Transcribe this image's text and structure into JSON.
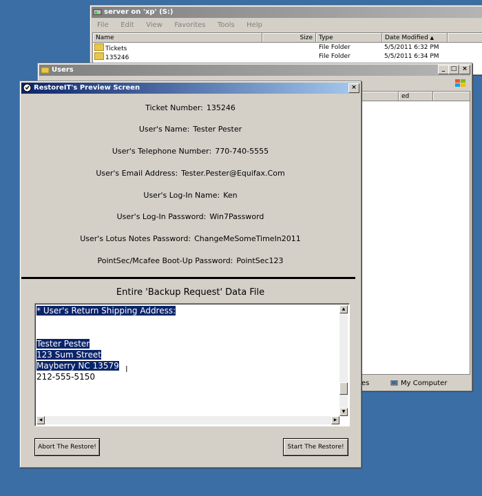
{
  "server_window": {
    "title": "server on 'xp' (S:)",
    "menu": [
      "File",
      "Edit",
      "View",
      "Favorites",
      "Tools",
      "Help"
    ],
    "columns": [
      "Name",
      "Size",
      "Type",
      "Date Modified"
    ],
    "rows": [
      {
        "name": "Tickets",
        "type": "File Folder",
        "date": "5/5/2011 6:32 PM"
      },
      {
        "name": "135246",
        "type": "File Folder",
        "date": "5/5/2011 6:34 PM"
      }
    ]
  },
  "users_window": {
    "title": "Users",
    "column_fragment": "ed",
    "status_left": "es",
    "status_right": "My Computer"
  },
  "dialog": {
    "title": "RestoreIT's Preview Screen",
    "close_glyph": "×",
    "fields": [
      {
        "label": "Ticket Number:",
        "value": "135246"
      },
      {
        "label": "User's Name:",
        "value": "Tester Pester"
      },
      {
        "label": "User's Telephone Number:",
        "value": "770-740-5555"
      },
      {
        "label": "User's Email Address:",
        "value": "Tester.Pester@Equifax.Com"
      },
      {
        "label": "User's Log-In Name:",
        "value": "Ken"
      },
      {
        "label": "User's Log-In Password:",
        "value": "Win7Password"
      },
      {
        "label": "User's Lotus Notes Password:",
        "value": "ChangeMeSomeTimeIn2011"
      },
      {
        "label": "PointSec/Mcafee Boot-Up Password:",
        "value": "PointSec123"
      }
    ],
    "section_title": "Entire 'Backup Request' Data File",
    "textarea": {
      "line1": "* User's Return Shipping Address:",
      "line2": "Tester Pester",
      "line3": "123 Sum Street",
      "line4": "Mayberry NC 13579",
      "line5": "212-555-5150"
    },
    "abort_button": "Abort The Restore!",
    "start_button": "Start The Restore!"
  }
}
